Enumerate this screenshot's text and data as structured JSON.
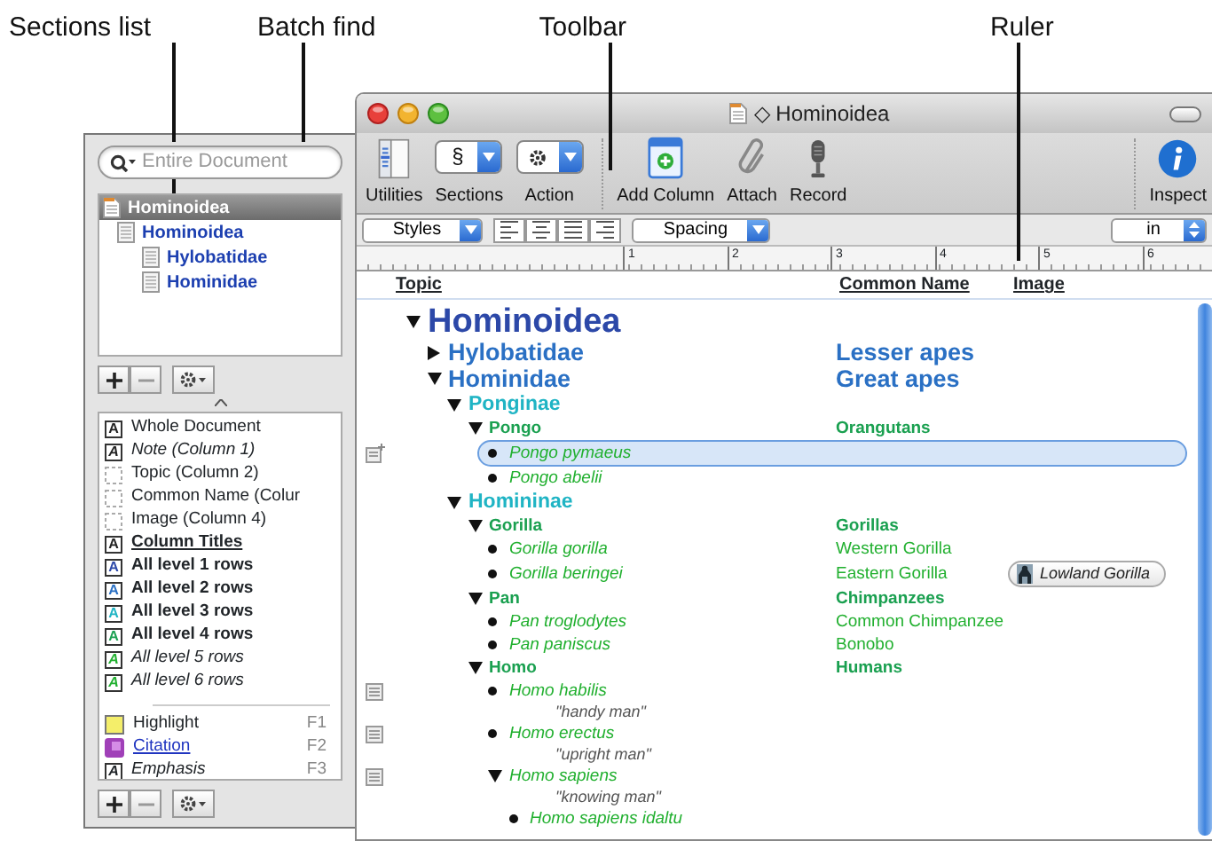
{
  "callouts": [
    {
      "label": "Sections list"
    },
    {
      "label": "Batch find"
    },
    {
      "label": "Toolbar"
    },
    {
      "label": "Ruler"
    }
  ],
  "drawer": {
    "search": {
      "placeholder": "Entire Document"
    },
    "sections": [
      {
        "label": "Hominoidea",
        "kind": "document",
        "selected": true
      },
      {
        "label": "Hominoidea",
        "kind": "section",
        "selected": false,
        "children": [
          {
            "label": "Hylobatidae",
            "kind": "section",
            "selected": false
          },
          {
            "label": "Hominidae",
            "kind": "section",
            "selected": false
          }
        ]
      }
    ],
    "styles": [
      {
        "kind": "document",
        "glyph": "A",
        "label": "Whole Document",
        "color": "#222222"
      },
      {
        "kind": "note",
        "glyph": "A",
        "label": "Note (Column 1)",
        "color": "#222222"
      },
      {
        "kind": "column",
        "label": "Topic (Column 2)"
      },
      {
        "kind": "column",
        "label": "Common Name (Colur"
      },
      {
        "kind": "column",
        "label": "Image (Column 4)"
      },
      {
        "kind": "titles",
        "glyph": "A",
        "label": "Column Titles",
        "color": "#222222"
      },
      {
        "kind": "level",
        "glyph": "A",
        "label": "All level 1 rows",
        "color": "#2c48a8"
      },
      {
        "kind": "level",
        "glyph": "A",
        "label": "All level 2 rows",
        "color": "#2a70c4"
      },
      {
        "kind": "level",
        "glyph": "A",
        "label": "All level 3 rows",
        "color": "#1fb4c4"
      },
      {
        "kind": "level",
        "glyph": "A",
        "label": "All level 4 rows",
        "color": "#1aa050"
      },
      {
        "kind": "level-italic",
        "glyph": "A",
        "label": "All level 5 rows",
        "color": "#22b030"
      },
      {
        "kind": "level-italic",
        "glyph": "A",
        "label": "All level 6 rows",
        "color": "#22b030"
      }
    ],
    "named_styles": [
      {
        "kind": "highlight",
        "label": "Highlight",
        "shortcut": "F1"
      },
      {
        "kind": "citation",
        "label": "Citation",
        "shortcut": "F2"
      },
      {
        "kind": "emphasis",
        "glyph": "A",
        "label": "Emphasis",
        "shortcut": "F3"
      }
    ]
  },
  "window": {
    "title": "◇ Hominoidea",
    "toolbar": {
      "left": [
        {
          "kind": "utilities",
          "label": "Utilities"
        },
        {
          "kind": "sections",
          "label": "Sections",
          "value": "§"
        },
        {
          "kind": "action",
          "label": "Action"
        }
      ],
      "middle": [
        {
          "kind": "add-column",
          "label": "Add Column"
        },
        {
          "kind": "attach",
          "label": "Attach"
        },
        {
          "kind": "record",
          "label": "Record"
        }
      ],
      "right": [
        {
          "kind": "inspect",
          "label": "Inspect"
        }
      ]
    },
    "format_bar": {
      "styles_popup": "Styles",
      "spacing_popup": "Spacing",
      "units_popup": "in"
    },
    "ruler": {
      "labels": [
        "1",
        "2",
        "3",
        "4",
        "5",
        "6"
      ]
    },
    "columns": [
      "Topic",
      "Common Name",
      "Image"
    ],
    "outline": [
      {
        "topic": "Hominoidea",
        "expanded": true,
        "selected": false,
        "children": [
          {
            "topic": "Hylobatidae",
            "common_name": "Lesser apes",
            "expanded": false,
            "selected": false
          },
          {
            "topic": "Hominidae",
            "common_name": "Great apes",
            "expanded": true,
            "selected": false,
            "children": [
              {
                "topic": "Ponginae",
                "expanded": true,
                "selected": false,
                "children": [
                  {
                    "topic": "Pongo",
                    "common_name": "Orangutans",
                    "expanded": true,
                    "selected": false,
                    "children": [
                      {
                        "topic": "Pongo pymaeus",
                        "selected": true
                      },
                      {
                        "topic": "Pongo abelii",
                        "selected": false
                      }
                    ]
                  }
                ]
              },
              {
                "topic": "Homininae",
                "expanded": true,
                "selected": false,
                "children": [
                  {
                    "topic": "Gorilla",
                    "common_name": "Gorillas",
                    "expanded": true,
                    "selected": false,
                    "children": [
                      {
                        "topic": "Gorilla gorilla",
                        "common_name": "Western Gorilla",
                        "selected": false
                      },
                      {
                        "topic": "Gorilla beringei",
                        "common_name": "Eastern Gorilla",
                        "image": "Lowland Gorilla",
                        "selected": false
                      }
                    ]
                  },
                  {
                    "topic": "Pan",
                    "common_name": "Chimpanzees",
                    "expanded": true,
                    "selected": false,
                    "children": [
                      {
                        "topic": "Pan troglodytes",
                        "common_name": "Common Chimpanzee",
                        "selected": false
                      },
                      {
                        "topic": "Pan paniscus",
                        "common_name": "Bonobo",
                        "selected": false
                      }
                    ]
                  },
                  {
                    "topic": "Homo",
                    "common_name": "Humans",
                    "expanded": true,
                    "selected": false,
                    "children": [
                      {
                        "topic": "Homo habilis",
                        "note": "\"handy man\"",
                        "selected": false
                      },
                      {
                        "topic": "Homo erectus",
                        "note": "\"upright man\"",
                        "selected": false
                      },
                      {
                        "topic": "Homo sapiens",
                        "note": "\"knowing man\"",
                        "expanded": true,
                        "selected": false,
                        "children": [
                          {
                            "topic": "Homo sapiens idaltu",
                            "selected": false
                          }
                        ]
                      }
                    ]
                  }
                ]
              }
            ]
          }
        ]
      }
    ]
  }
}
